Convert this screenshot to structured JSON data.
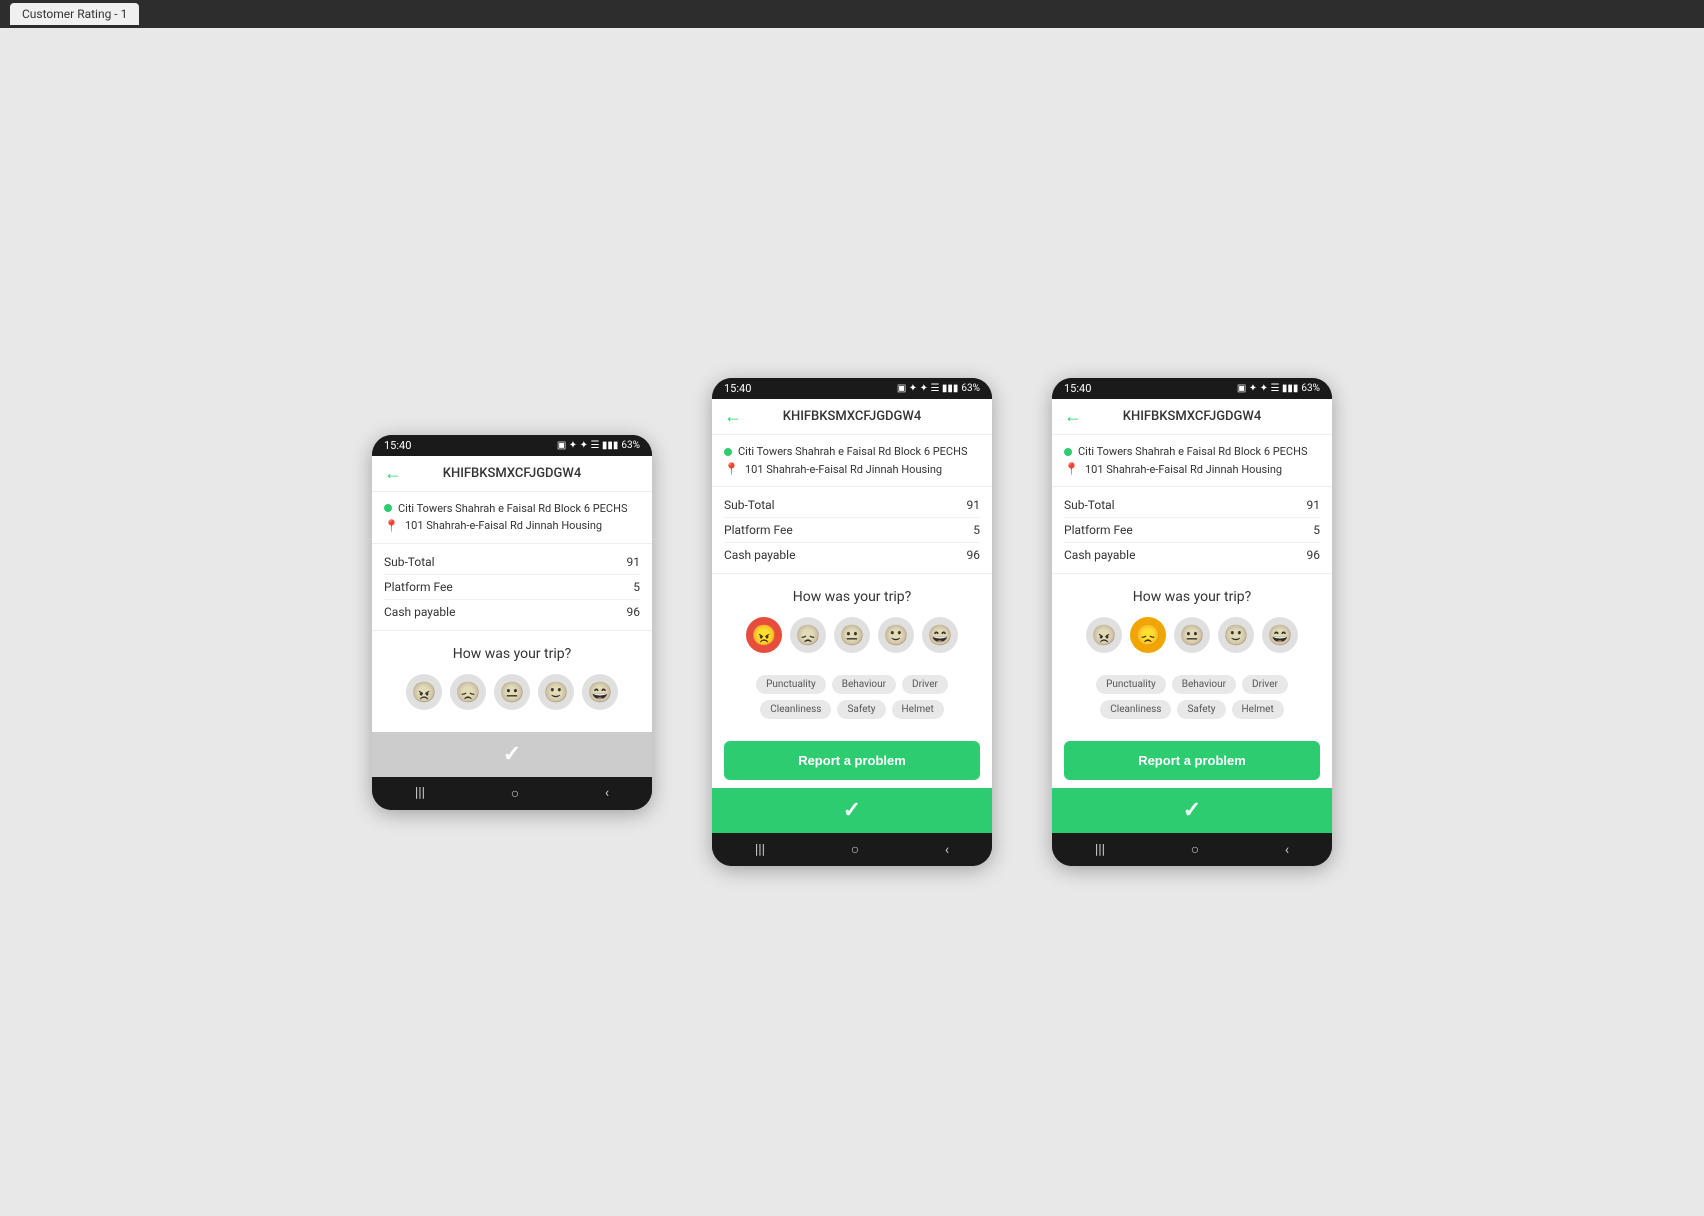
{
  "browser": {
    "tab_label": "Customer Rating - 1"
  },
  "phones": [
    {
      "id": "phone1",
      "status_bar": {
        "time": "15:40",
        "battery": "63%"
      },
      "header": {
        "back": "←",
        "trip_id": "KHIFBKSMXCFJGDGW4"
      },
      "route": {
        "origin": "Citi Towers  Shahrah e Faisal Rd Block 6 PECHS",
        "destination": "101 Shahrah-e-Faisal Rd   Jinnah Housing"
      },
      "fare": [
        {
          "label": "Sub-Total",
          "value": "91"
        },
        {
          "label": "Platform Fee",
          "value": "5"
        },
        {
          "label": "Cash payable",
          "value": "96"
        }
      ],
      "rating": {
        "question": "How was your trip?",
        "emojis": [
          {
            "type": "angry",
            "char": "😠",
            "active": false
          },
          {
            "type": "sad",
            "char": "😞",
            "active": false
          },
          {
            "type": "neutral",
            "char": "😐",
            "active": false
          },
          {
            "type": "happy",
            "char": "🙂",
            "active": false
          },
          {
            "type": "very-happy",
            "char": "😄",
            "active": false
          }
        ],
        "tags_visible": false,
        "report_visible": false
      },
      "bottom": {
        "type": "gray",
        "check": "✓"
      }
    },
    {
      "id": "phone2",
      "status_bar": {
        "time": "15:40",
        "battery": "63%"
      },
      "header": {
        "back": "←",
        "trip_id": "KHIFBKSMXCFJGDGW4"
      },
      "route": {
        "origin": "Citi Towers  Shahrah e Faisal Rd Block 6 PECHS",
        "destination": "101 Shahrah-e-Faisal Rd   Jinnah Housing"
      },
      "fare": [
        {
          "label": "Sub-Total",
          "value": "91"
        },
        {
          "label": "Platform Fee",
          "value": "5"
        },
        {
          "label": "Cash payable",
          "value": "96"
        }
      ],
      "rating": {
        "question": "How was your trip?",
        "emojis": [
          {
            "type": "angry",
            "char": "😠",
            "active": true,
            "color": "red"
          },
          {
            "type": "sad",
            "char": "😞",
            "active": false
          },
          {
            "type": "neutral",
            "char": "😐",
            "active": false
          },
          {
            "type": "happy",
            "char": "🙂",
            "active": false
          },
          {
            "type": "very-happy",
            "char": "😄",
            "active": false
          }
        ],
        "tags_visible": true,
        "tags_row1": [
          "Punctuality",
          "Behaviour",
          "Driver"
        ],
        "tags_row2": [
          "Cleanliness",
          "Safety",
          "Helmet"
        ],
        "report_visible": true,
        "report_label": "Report a problem"
      },
      "bottom": {
        "type": "green",
        "check": "✓"
      }
    },
    {
      "id": "phone3",
      "status_bar": {
        "time": "15:40",
        "battery": "63%"
      },
      "header": {
        "back": "←",
        "trip_id": "KHIFBKSMXCFJGDGW4"
      },
      "route": {
        "origin": "Citi Towers  Shahrah e Faisal Rd Block 6 PECHS",
        "destination": "101 Shahrah-e-Faisal Rd   Jinnah Housing"
      },
      "fare": [
        {
          "label": "Sub-Total",
          "value": "91"
        },
        {
          "label": "Platform Fee",
          "value": "5"
        },
        {
          "label": "Cash payable",
          "value": "96"
        }
      ],
      "rating": {
        "question": "How was your trip?",
        "emojis": [
          {
            "type": "angry",
            "char": "😠",
            "active": false
          },
          {
            "type": "sad",
            "char": "😞",
            "active": true,
            "color": "yellow"
          },
          {
            "type": "neutral",
            "char": "😐",
            "active": false
          },
          {
            "type": "happy",
            "char": "🙂",
            "active": false
          },
          {
            "type": "very-happy",
            "char": "😄",
            "active": false
          }
        ],
        "tags_visible": true,
        "tags_row1": [
          "Punctuality",
          "Behaviour",
          "Driver"
        ],
        "tags_row2": [
          "Cleanliness",
          "Safety",
          "Helmet"
        ],
        "report_visible": true,
        "report_label": "Report a problem"
      },
      "bottom": {
        "type": "green",
        "check": "✓"
      }
    }
  ]
}
